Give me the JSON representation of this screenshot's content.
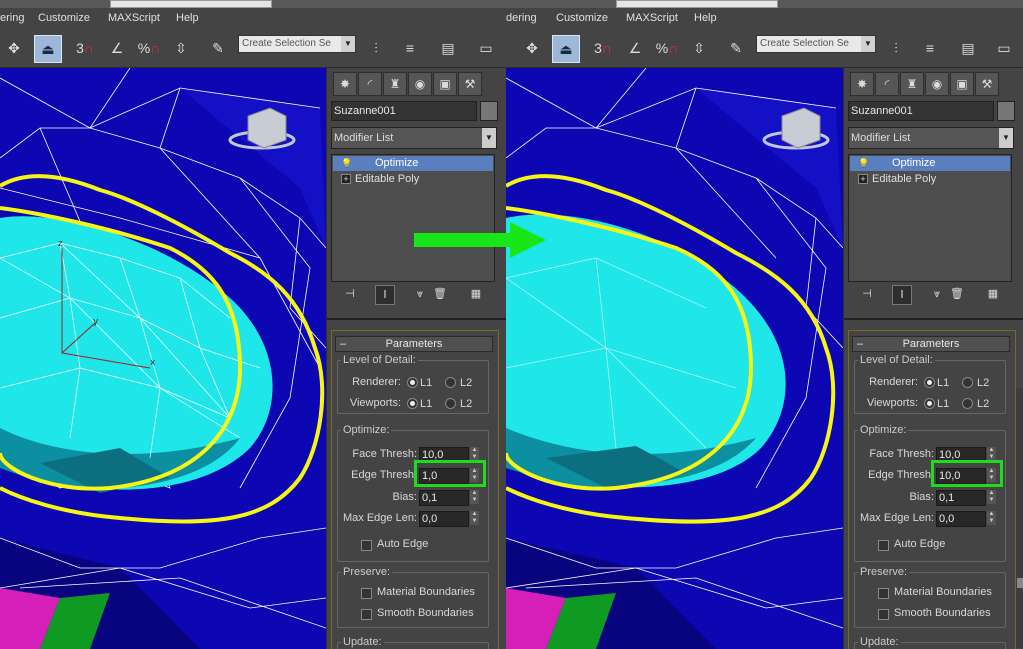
{
  "menu": [
    "ering",
    "Customize",
    "MAXScript",
    "Help"
  ],
  "menu_right": [
    "dering",
    "Customize",
    "MAXScript",
    "Help"
  ],
  "toolbar": {
    "selection_set_placeholder": "Create Selection Se",
    "snap_label": "3",
    "angle_snap": "%"
  },
  "panels": [
    {
      "object_name": "Suzanne001",
      "modifier_list": "Modifier List",
      "stack": [
        "Optimize",
        "Editable Poly"
      ],
      "rollout_title": "Parameters",
      "lod_group": "Level of Detail:",
      "renderer_label": "Renderer:",
      "viewports_label": "Viewports:",
      "l1": "L1",
      "l2": "L2",
      "optimize_group": "Optimize:",
      "face_thresh_label": "Face Thresh:",
      "face_thresh_value": "10,0",
      "edge_thresh_label": "Edge Thresh:",
      "edge_thresh_value": "1,0",
      "bias_label": "Bias:",
      "bias_value": "0,1",
      "max_edge_label": "Max Edge Len:",
      "max_edge_value": "0,0",
      "auto_edge": "Auto Edge",
      "preserve_group": "Preserve:",
      "material_boundaries": "Material Boundaries",
      "smooth_boundaries": "Smooth Boundaries",
      "update_group": "Update:"
    },
    {
      "object_name": "Suzanne001",
      "modifier_list": "Modifier List",
      "stack": [
        "Optimize",
        "Editable Poly"
      ],
      "rollout_title": "Parameters",
      "lod_group": "Level of Detail:",
      "renderer_label": "Renderer:",
      "viewports_label": "Viewports:",
      "l1": "L1",
      "l2": "L2",
      "optimize_group": "Optimize:",
      "face_thresh_label": "Face Thresh:",
      "face_thresh_value": "10,0",
      "edge_thresh_label": "Edge Thresh:",
      "edge_thresh_value": "10,0",
      "bias_label": "Bias:",
      "bias_value": "0,1",
      "max_edge_label": "Max Edge Len:",
      "max_edge_value": "0,0",
      "auto_edge": "Auto Edge",
      "preserve_group": "Preserve:",
      "material_boundaries": "Material Boundaries",
      "smooth_boundaries": "Smooth Boundaries",
      "update_group": "Update:"
    }
  ],
  "viewport": {
    "axis_labels": [
      "z",
      "y",
      "x"
    ],
    "colors": {
      "background": "#0d06b3",
      "mesh_light": "#1fe6e8",
      "mesh_dark": "#0c8fa0",
      "wire": "#ffffff",
      "highlight_outline": "#f5f516",
      "highlight_box": "#1edb22",
      "arrow": "#19e619"
    }
  },
  "icons": [
    "move-icon",
    "select-object-icon",
    "snap-icon",
    "angle-snap-icon",
    "percent-snap-icon",
    "spinner-snap-icon",
    "edit-named-selection-icon",
    "mirror-icon",
    "align-icon",
    "layer-icon",
    "render-setup-icon",
    "create-tab-icon",
    "modify-tab-icon",
    "hierarchy-tab-icon",
    "motion-tab-icon",
    "display-tab-icon",
    "utilities-tab-icon",
    "lightbulb-icon",
    "pin-stack-icon",
    "show-end-result-icon",
    "make-unique-icon",
    "remove-modifier-icon",
    "configure-sets-icon",
    "viewcube-icon"
  ]
}
